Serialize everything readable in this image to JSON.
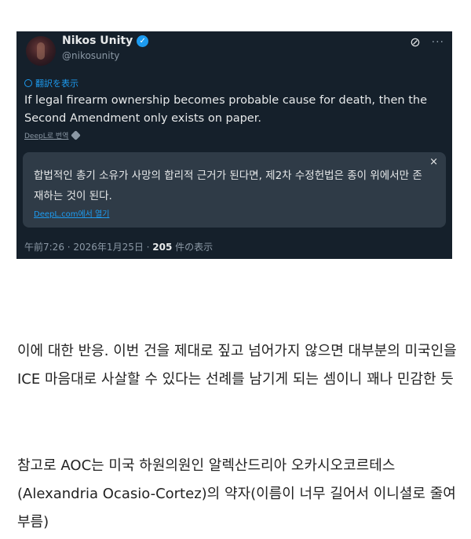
{
  "tweet": {
    "display_name": "Nikos Unity",
    "handle": "@nikosunity",
    "translate_label": "翻訳を表示",
    "text": "If legal firearm ownership becomes probable cause for death, then the Second Amendment only exists on paper.",
    "deepl_label": "DeepL로 번역",
    "translation": {
      "text": "합법적인 총기 소유가 사망의 합리적 근거가 된다면, 제2차 수정헌법은 종이 위에서만 존재하는 것이 된다.",
      "open_label": "DeepL.com에서 열기",
      "close_symbol": "×"
    },
    "meta": {
      "time_date": "午前7:26 · 2026年1月25日 · ",
      "views": "205",
      "views_label": " 件の表示"
    },
    "icons": {
      "verified": "verified-badge-icon",
      "grok": "grok-icon",
      "more": "more-icon",
      "translate": "translate-icon",
      "deepl": "deepl-logo-icon",
      "close": "close-icon"
    },
    "colors": {
      "background": "#15202b",
      "accent": "#1d9bf0",
      "translation_bg": "#2f3b47"
    }
  },
  "body": {
    "paragraph1": "이에 대한 반응. 이번 건을 제대로 짚고 넘어가지 않으면 대부분의 미국인을 ICE 마음대로 사살할 수 있다는 선례를 남기게 되는 셈이니 꽤나 민감한 듯",
    "paragraph2": "참고로 AOC는 미국 하원의원인 알렉산드리아 오카시오코르테스(Alexandria Ocasio-Cortez)의 약자(이름이 너무 길어서 이니셜로 줄여 부름)"
  }
}
